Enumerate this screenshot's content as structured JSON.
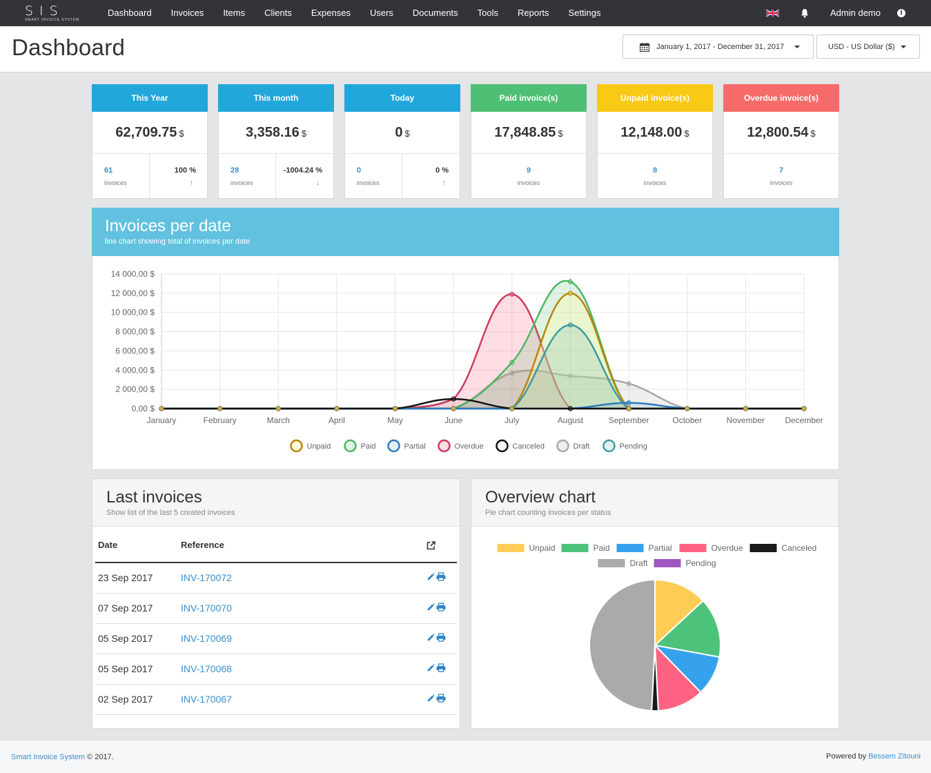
{
  "app": {
    "logo_text": "SIS",
    "logo_subtitle": "SMART INVOICE SYSTEM"
  },
  "nav": {
    "items": [
      "Dashboard",
      "Invoices",
      "Items",
      "Clients",
      "Expenses",
      "Users",
      "Documents",
      "Tools",
      "Reports",
      "Settings"
    ],
    "user": "Admin demo",
    "icons": [
      "uk-flag-icon",
      "bell-icon",
      "info-icon"
    ]
  },
  "header": {
    "title": "Dashboard",
    "date_range": "January 1, 2017 - December 31, 2017",
    "currency": "USD - US Dollar ($)"
  },
  "stats": [
    {
      "title": "This Year",
      "color": "#22a7da",
      "amount": "62,709.75",
      "currency": "$",
      "count": "61",
      "count_label": "invoices",
      "percent": "100 %",
      "trend": "up"
    },
    {
      "title": "This month",
      "color": "#22a7da",
      "amount": "3,358.16",
      "currency": "$",
      "count": "28",
      "count_label": "invoices",
      "percent": "-1004.24 %",
      "trend": "down"
    },
    {
      "title": "Today",
      "color": "#22a7da",
      "amount": "0",
      "currency": "$",
      "count": "0",
      "count_label": "invoices",
      "percent": "0 %",
      "trend": "up"
    },
    {
      "title": "Paid invoice(s)",
      "color": "#4fbf75",
      "amount": "17,848.85",
      "currency": "$",
      "count": "9",
      "count_label": "invoices"
    },
    {
      "title": "Unpaid invoice(s)",
      "color": "#f8c915",
      "amount": "12,148.00",
      "currency": "$",
      "count": "8",
      "count_label": "invoices"
    },
    {
      "title": "Overdue invoice(s)",
      "color": "#f66b69",
      "amount": "12,800.54",
      "currency": "$",
      "count": "7",
      "count_label": "invoices"
    }
  ],
  "line_panel": {
    "title": "Invoices per date",
    "subtitle": "line chart showing total of invoices per date"
  },
  "last_invoices": {
    "title": "Last invoices",
    "subtitle": "Show list of the last 5 created invoices",
    "columns": [
      "Date",
      "Reference"
    ],
    "rows": [
      {
        "date": "23 Sep 2017",
        "reference": "INV-170072"
      },
      {
        "date": "07 Sep 2017",
        "reference": "INV-170070"
      },
      {
        "date": "05 Sep 2017",
        "reference": "INV-170069"
      },
      {
        "date": "05 Sep 2017",
        "reference": "INV-170068"
      },
      {
        "date": "02 Sep 2017",
        "reference": "INV-170067"
      }
    ]
  },
  "overview": {
    "title": "Overview chart",
    "subtitle": "Pie chart counting invoices per status"
  },
  "footer": {
    "left_link": "Smart Invoice System",
    "left_text": "© 2017.",
    "right_text": "Powered by",
    "right_link": "Bessem Zitouni"
  },
  "chart_data": [
    {
      "type": "line",
      "categories": [
        "January",
        "February",
        "March",
        "April",
        "May",
        "June",
        "July",
        "August",
        "September",
        "October",
        "November",
        "December"
      ],
      "ylim": [
        0,
        14000
      ],
      "yticks": [
        0,
        2000,
        4000,
        6000,
        8000,
        10000,
        12000,
        14000
      ],
      "ytick_labels": [
        "0,00 $",
        "2 000,00 $",
        "4 000,00 $",
        "6 000,00 $",
        "8 000,00 $",
        "10 000,00 $",
        "12 000,00 $",
        "14 000,00 $"
      ],
      "grid": true,
      "legend_position": "bottom",
      "series": [
        {
          "name": "Unpaid",
          "color": "#b8860b",
          "fill": "rgba(255,255,170,0.35)",
          "values": [
            0,
            0,
            0,
            0,
            0,
            0,
            0,
            12000,
            0,
            0,
            0,
            0
          ]
        },
        {
          "name": "Paid",
          "color": "#4cb862",
          "fill": "rgba(76,184,98,0.18)",
          "values": [
            0,
            0,
            0,
            0,
            0,
            0,
            4800,
            13200,
            0,
            0,
            0,
            0
          ]
        },
        {
          "name": "Partial",
          "color": "#2e7bbf",
          "fill": "rgba(46,123,191,0.12)",
          "values": [
            0,
            0,
            0,
            0,
            0,
            0,
            0,
            0,
            600,
            0,
            0,
            0
          ]
        },
        {
          "name": "Overdue",
          "color": "#cc3b5b",
          "fill": "rgba(255,99,132,0.22)",
          "values": [
            0,
            0,
            0,
            0,
            0,
            1000,
            11900,
            0,
            0,
            0,
            0,
            0
          ]
        },
        {
          "name": "Canceled",
          "color": "#111111",
          "fill": "rgba(0,0,0,0.05)",
          "values": [
            0,
            0,
            0,
            0,
            0,
            1000,
            0,
            0,
            0,
            0,
            0,
            0
          ]
        },
        {
          "name": "Draft",
          "color": "#a8a8a8",
          "fill": "rgba(168,168,168,0.18)",
          "values": [
            0,
            0,
            0,
            0,
            0,
            0,
            3700,
            3400,
            2600,
            0,
            0,
            0
          ]
        },
        {
          "name": "Pending",
          "color": "#3f9a9f",
          "fill": "rgba(63,154,159,0.15)",
          "values": [
            0,
            0,
            0,
            0,
            0,
            0,
            0,
            8700,
            0,
            0,
            0,
            0
          ]
        }
      ]
    },
    {
      "type": "pie",
      "legend_position": "top",
      "labels": [
        "Unpaid",
        "Paid",
        "Partial",
        "Overdue",
        "Canceled",
        "Draft",
        "Pending"
      ],
      "colors": [
        "#ffcd56",
        "#4dc27b",
        "#36a2eb",
        "#ff6384",
        "#1a1a1a",
        "#aaaaaa",
        "#a057c0"
      ],
      "values": [
        8,
        9,
        6,
        7,
        1,
        30,
        0
      ]
    }
  ]
}
